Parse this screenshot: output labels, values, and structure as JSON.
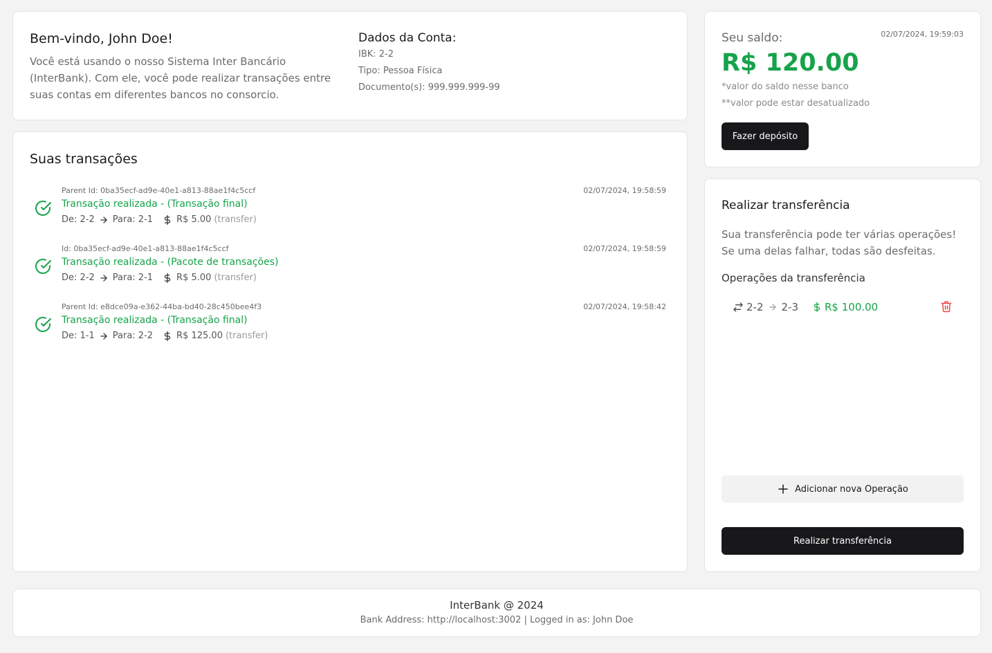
{
  "welcome": {
    "title": "Bem-vindo, John Doe!",
    "description": "Você está usando o nosso Sistema Inter Bancário (InterBank). Com ele, você pode realizar transações entre suas contas em diferentes bancos no consorcio.",
    "account_title": "Dados da Conta:",
    "ibk": "IBK: 2-2",
    "type": "Tipo: Pessoa Física",
    "documents": "Documento(s): 999.999.999-99"
  },
  "balance": {
    "label": "Seu saldo:",
    "timestamp": "02/07/2024, 19:59:03",
    "amount": "R$ 120.00",
    "note1": "*valor do saldo nesse banco",
    "note2": "**valor pode estar desatualizado",
    "deposit_button": "Fazer depósito"
  },
  "transactions": {
    "title": "Suas transações",
    "items": [
      {
        "id_label": "Parent Id: 0ba35ecf-ad9e-40e1-a813-88ae1f4c5ccf",
        "date": "02/07/2024, 19:58:59",
        "status": "Transação realizada - (Transação final)",
        "from": "De: 2-2",
        "to": "Para: 2-1",
        "amount": "R$ 5.00",
        "kind": "(transfer)"
      },
      {
        "id_label": "Id: 0ba35ecf-ad9e-40e1-a813-88ae1f4c5ccf",
        "date": "02/07/2024, 19:58:59",
        "status": "Transação realizada - (Pacote de transações)",
        "from": "De: 2-2",
        "to": "Para: 2-1",
        "amount": "R$ 5.00",
        "kind": "(transfer)"
      },
      {
        "id_label": "Parent Id: e8dce09a-e362-44ba-bd40-28c450bee4f3",
        "date": "02/07/2024, 19:58:42",
        "status": "Transação realizada - (Transação final)",
        "from": "De: 1-1",
        "to": "Para: 2-2",
        "amount": "R$ 125.00",
        "kind": "(transfer)"
      }
    ]
  },
  "transfer": {
    "title": "Realizar transferência",
    "description": "Sua transferência pode ter várias operações! Se uma delas falhar, todas são desfeitas.",
    "ops_title": "Operações da transferência",
    "operations": [
      {
        "from": "2-2",
        "to": "2-3",
        "amount": "R$ 100.00"
      }
    ],
    "add_button": "Adicionar nova Operação",
    "submit_button": "Realizar transferência"
  },
  "footer": {
    "line1": "InterBank @ 2024",
    "line2": "Bank Address: http://localhost:3002 | Logged in as: John Doe"
  },
  "colors": {
    "accent_green": "#16a34a",
    "danger_red": "#ef4444",
    "button_dark": "#18181b"
  }
}
